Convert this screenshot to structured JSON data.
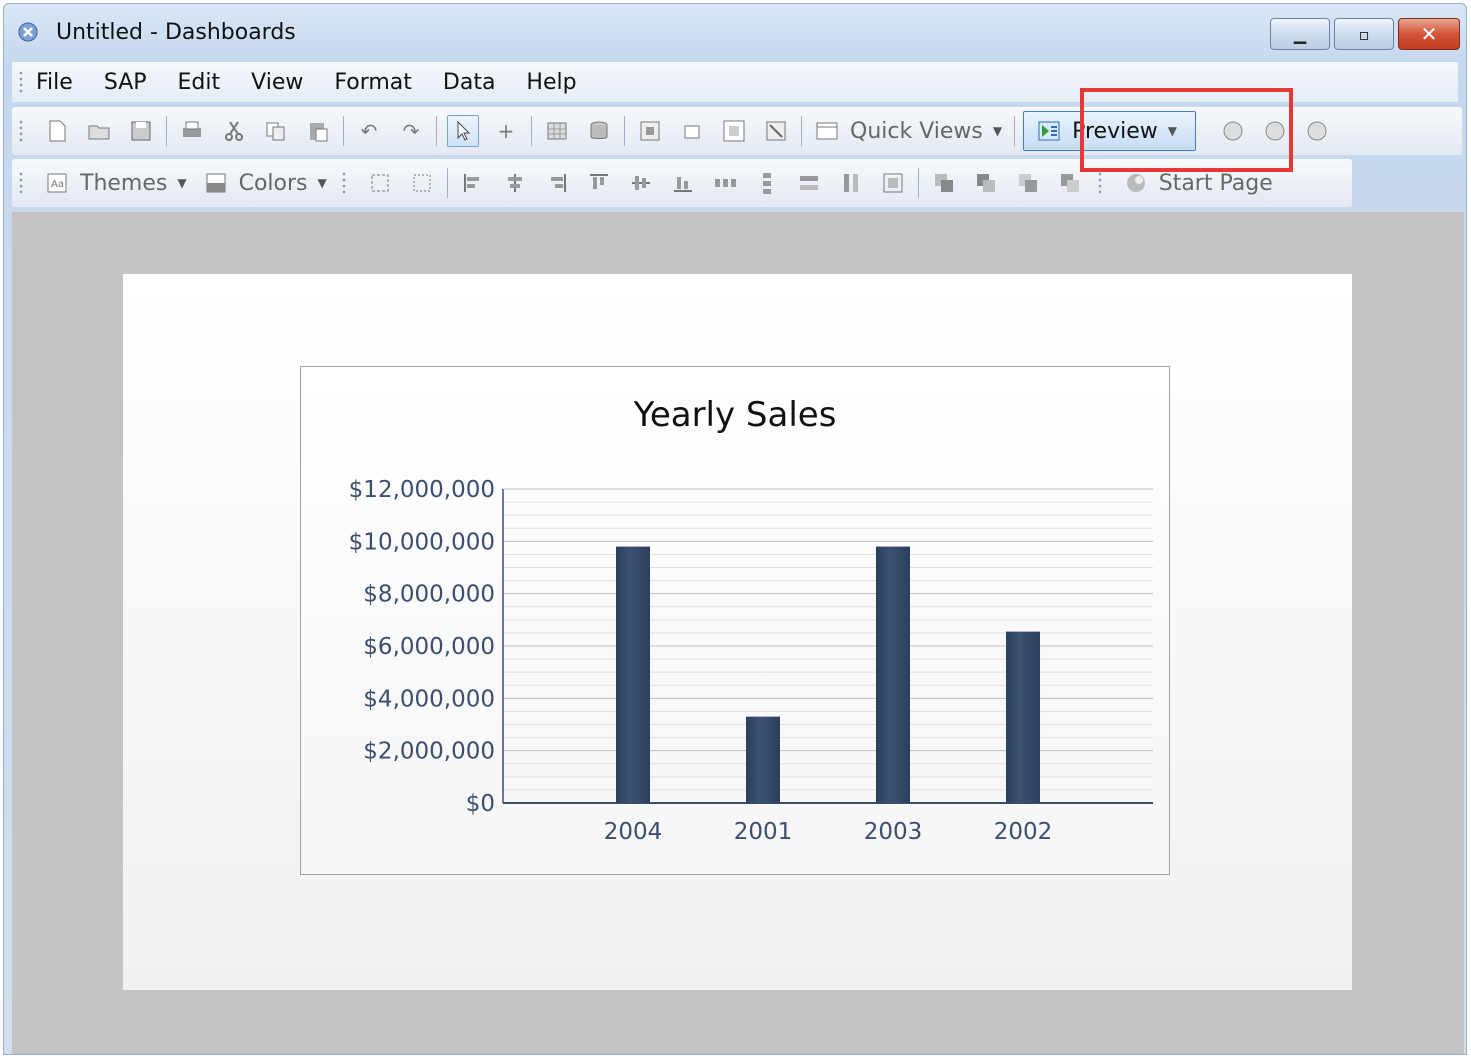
{
  "window": {
    "title": "Untitled - Dashboards"
  },
  "menu": {
    "items": [
      "File",
      "SAP",
      "Edit",
      "View",
      "Format",
      "Data",
      "Help"
    ]
  },
  "toolbar": {
    "quick_views_label": "Quick Views",
    "preview_label": "Preview",
    "themes_label": "Themes",
    "colors_label": "Colors",
    "start_page_label": "Start Page"
  },
  "chart_data": {
    "type": "bar",
    "title": "Yearly Sales",
    "categories": [
      "2004",
      "2001",
      "2003",
      "2002"
    ],
    "values": [
      9800000,
      3300000,
      9800000,
      6550000
    ],
    "ylim": [
      0,
      12000000
    ],
    "yticks": [
      "$0",
      "$2,000,000",
      "$4,000,000",
      "$6,000,000",
      "$8,000,000",
      "$10,000,000",
      "$12,000,000"
    ],
    "xlabel": "",
    "ylabel": "",
    "grid": true,
    "bar_color": "#3c5273"
  }
}
